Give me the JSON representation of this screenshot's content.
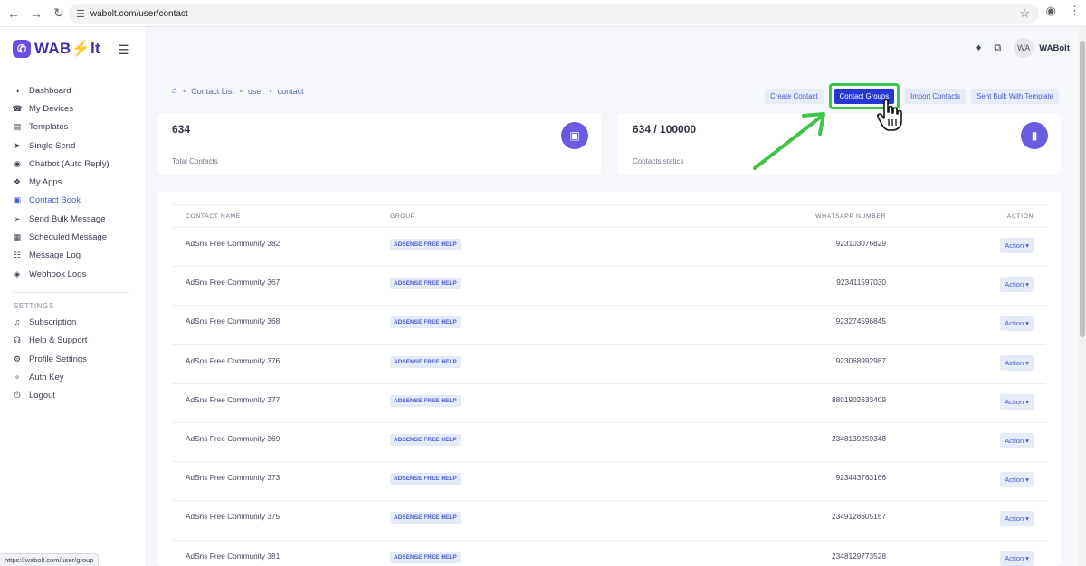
{
  "browser": {
    "url": "wabolt.com/user/contact",
    "status_url": "https://wabolt.com/user/group"
  },
  "brand": {
    "name": "WAB⚡lt"
  },
  "nav": {
    "items": [
      {
        "label": "Dashboard",
        "icon": "dashboard-icon"
      },
      {
        "label": "My Devices",
        "icon": "devices-icon"
      },
      {
        "label": "Templates",
        "icon": "templates-icon"
      },
      {
        "label": "Single Send",
        "icon": "send-icon"
      },
      {
        "label": "Chatbot (Auto Reply)",
        "icon": "robot-icon"
      },
      {
        "label": "My Apps",
        "icon": "apps-icon"
      },
      {
        "label": "Contact Book",
        "icon": "contact-book-icon"
      },
      {
        "label": "Send Bulk Message",
        "icon": "bulk-icon"
      },
      {
        "label": "Scheduled Message",
        "icon": "calendar-icon"
      },
      {
        "label": "Message Log",
        "icon": "log-icon"
      },
      {
        "label": "Webhook Logs",
        "icon": "webhook-icon"
      }
    ],
    "settings_title": "SETTINGS",
    "settings_items": [
      {
        "label": "Subscription",
        "icon": "subscription-icon"
      },
      {
        "label": "Help & Support",
        "icon": "support-icon"
      },
      {
        "label": "Profile Settings",
        "icon": "gear-icon"
      },
      {
        "label": "Auth Key",
        "icon": "key-icon"
      },
      {
        "label": "Logout",
        "icon": "power-icon"
      }
    ]
  },
  "header": {
    "avatar_initials": "WA",
    "user_name": "WABolt"
  },
  "breadcrumb": [
    "Contact List",
    "user",
    "contact"
  ],
  "actions": {
    "create": "Create Contact",
    "groups": "Contact Groups",
    "import": "Import Contacts",
    "bulk": "Sent Bulk With Template"
  },
  "stats": [
    {
      "value": "634",
      "label": "Total Contacts",
      "icon": "contact-card-icon"
    },
    {
      "value": "634 / 100000",
      "label": "Contacts statics",
      "icon": "signal-icon"
    }
  ],
  "table": {
    "headers": [
      "CONTACT NAME",
      "GROUP",
      "WHATSAPP NUMBER",
      "ACTION"
    ],
    "rows": [
      {
        "name": "AdSns Free Community 382",
        "group": "ADSENSE FREE HELP",
        "number": "923103076829",
        "action": "Action"
      },
      {
        "name": "AdSns Free Community 367",
        "group": "ADSENSE FREE HELP",
        "number": "923411597030",
        "action": "Action"
      },
      {
        "name": "AdSns Free Community 368",
        "group": "ADSENSE FREE HELP",
        "number": "923274596845",
        "action": "Action"
      },
      {
        "name": "AdSns Free Community 376",
        "group": "ADSENSE FREE HELP",
        "number": "923068992987",
        "action": "Action"
      },
      {
        "name": "AdSns Free Community 377",
        "group": "ADSENSE FREE HELP",
        "number": "8801902633409",
        "action": "Action"
      },
      {
        "name": "AdSns Free Community 369",
        "group": "ADSENSE FREE HELP",
        "number": "2348139259348",
        "action": "Action"
      },
      {
        "name": "AdSns Free Community 373",
        "group": "ADSENSE FREE HELP",
        "number": "923443763166",
        "action": "Action"
      },
      {
        "name": "AdSns Free Community 375",
        "group": "ADSENSE FREE HELP",
        "number": "2349128605167",
        "action": "Action"
      },
      {
        "name": "AdSns Free Community 381",
        "group": "ADSENSE FREE HELP",
        "number": "2348129773528",
        "action": "Action"
      }
    ]
  },
  "colors": {
    "primary": "#2837d4",
    "accent": "#6b5be2",
    "highlight": "#41c24a"
  }
}
